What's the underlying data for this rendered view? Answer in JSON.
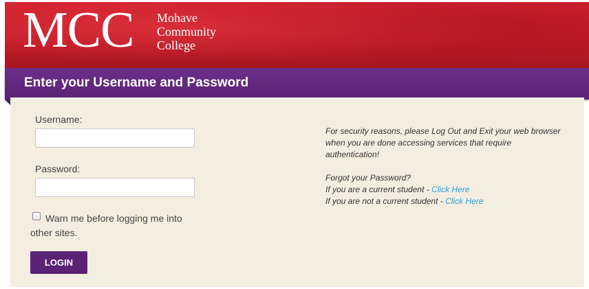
{
  "header": {
    "logo_mcc": "MCC",
    "logo_line1": "Mohave",
    "logo_line2": "Community",
    "logo_line3": "College"
  },
  "title": "Enter your Username and Password",
  "form": {
    "username_label": "Username:",
    "username_value": "",
    "password_label": "Password:",
    "password_value": "",
    "warn_label": "Warn me before logging me into other sites.",
    "warn_checked": false,
    "login_label": "LOGIN"
  },
  "info": {
    "security_note": "For security reasons, please Log Out and Exit your web browser when you are done accessing services that require authentication!",
    "forgot_title": "Forgot your Password?",
    "current_prefix": "If you are a current student - ",
    "current_link": "Click Here",
    "not_current_prefix": "If you are not a current student - ",
    "not_current_link": "Click Here"
  },
  "colors": {
    "header_red": "#c11b28",
    "title_purple": "#5b2275",
    "content_bg": "#f4eee0",
    "link_blue": "#2a9fd8"
  }
}
